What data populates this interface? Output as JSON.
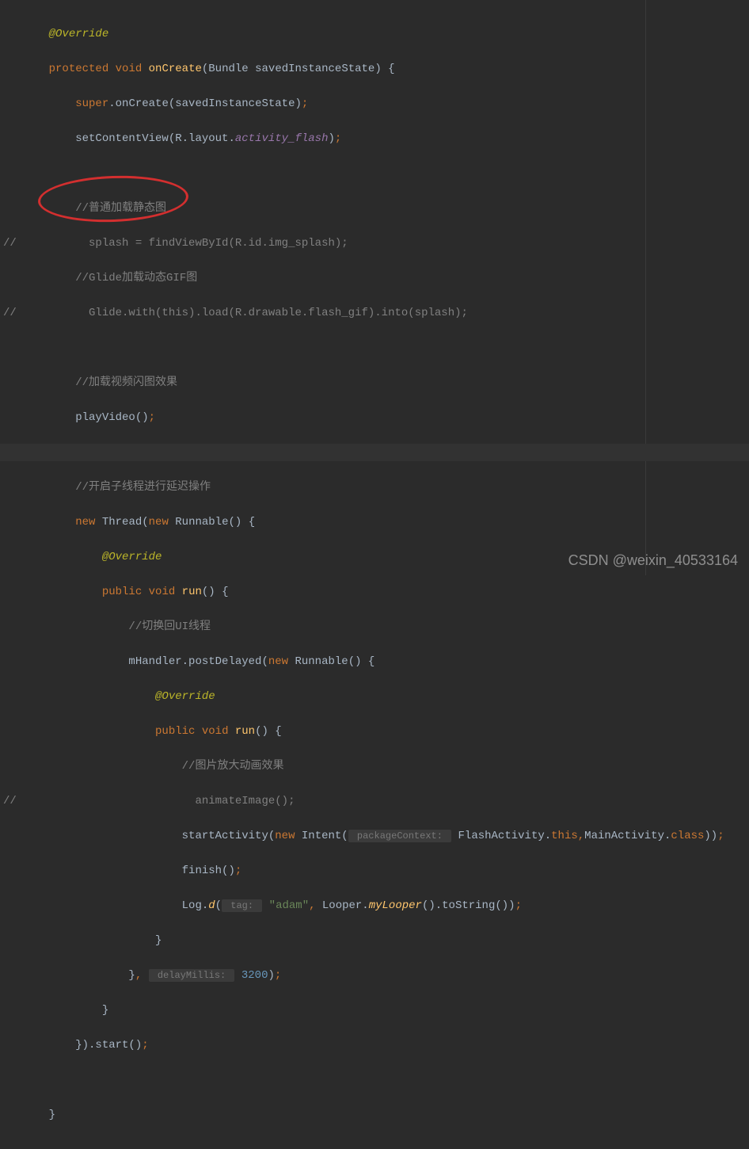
{
  "code": {
    "l1_annotation": "@Override",
    "l2_protected": "protected",
    "l2_void": "void",
    "l2_method": "onCreate",
    "l2_paren_open": "(",
    "l2_param_type": "Bundle",
    "l2_param_name": "savedInstanceState",
    "l2_paren_close": ")",
    "l2_brace": " {",
    "l3_super": "super",
    "l3_call": ".onCreate(savedInstanceState)",
    "l3_semi": ";",
    "l4_call": "setContentView(R.layout.",
    "l4_italic": "activity_flash",
    "l4_close": ")",
    "l4_semi": ";",
    "l6_comment": "//普通加载静态图",
    "l7_gutter": "//",
    "l7_code": "  splash = findViewById(R.id.img_splash);",
    "l8_comment": "//Glide加载动态GIF图",
    "l9_gutter": "//",
    "l9_code": "  Glide.with(this).load(R.drawable.flash_gif).into(splash);",
    "l11_comment": "//加载视频闪图效果",
    "l12_call": "playVideo()",
    "l12_semi": ";",
    "l14_comment": "//开启子线程进行延迟操作",
    "l15_new": "new",
    "l15_thread": " Thread(",
    "l15_new2": "new",
    "l15_runnable": " Runnable() {",
    "l16_annotation": "@Override",
    "l17_public": "public",
    "l17_void": "void",
    "l17_run": "run",
    "l17_rest": "() {",
    "l18_comment": "//切换回UI线程",
    "l19_handler": "mHandler",
    "l19_post": ".postDelayed(",
    "l19_new": "new",
    "l19_runnable": " Runnable() {",
    "l20_annotation": "@Override",
    "l21_public": "public",
    "l21_void": "void",
    "l21_run": "run",
    "l21_rest": "() {",
    "l22_comment": "//图片放大动画效果",
    "l23_gutter": "//",
    "l23_code": "  animateImage();",
    "l24_start": "startActivity(",
    "l24_new": "new",
    "l24_intent": " Intent(",
    "l24_hint": " packageContext: ",
    "l24_flash": " FlashActivity.",
    "l24_this": "this",
    "l24_comma": ",",
    "l24_main": "MainActivity.",
    "l24_class": "class",
    "l24_close": "))",
    "l24_semi": ";",
    "l25_finish": "finish()",
    "l25_semi": ";",
    "l26_log": "Log.",
    "l26_d": "d",
    "l26_open": "(",
    "l26_hint": " tag: ",
    "l26_str": " \"adam\"",
    "l26_comma": ",",
    "l26_looper": " Looper.",
    "l26_mylooper": "myLooper",
    "l26_rest": "().toString())",
    "l26_semi": ";",
    "l27_brace": "}",
    "l28_brace": "}",
    "l28_comma": ",",
    "l28_hint": " delayMillis: ",
    "l28_num": " 3200",
    "l28_close": ")",
    "l28_semi": ";",
    "l29_brace": "}",
    "l30_close": "}).start()",
    "l30_semi": ";",
    "l32_brace": "}"
  },
  "watermark": "CSDN @weixin_40533164"
}
